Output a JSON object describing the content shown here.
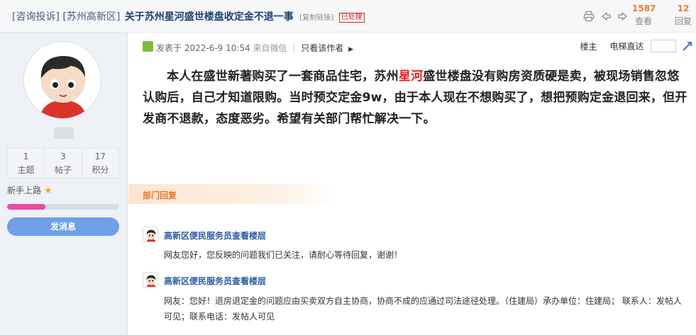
{
  "header": {
    "category1": "[咨询投诉]",
    "category2": "[苏州高新区]",
    "title": "关于苏州星河盛世楼盘收定金不退一事",
    "copy_link": "[复制链接]",
    "status": "已处理",
    "views_count": "1587",
    "views_label": "查看",
    "replies_count": "12",
    "replies_label": "回复",
    "icons": [
      "print-icon",
      "prev-thread-icon",
      "next-thread-icon"
    ]
  },
  "sidebar": {
    "stats": [
      {
        "value": "1",
        "label": "主题"
      },
      {
        "value": "3",
        "label": "帖子"
      },
      {
        "value": "17",
        "label": "积分"
      }
    ],
    "level": "新手上路",
    "level_progress": 0.34,
    "message_button": "发消息"
  },
  "post": {
    "time": "发表于 2022-6-9 10:54",
    "source": "来自微信",
    "only_author": "只看该作者",
    "floor": "楼主",
    "jump_label": "电梯直达",
    "content_before": "本人在盛世新著购买了一套商品住宅，苏州",
    "content_highlight": "星河",
    "content_after": "盛世楼盘没有购房资质硬是卖，被现场销售忽悠认购后，自己才知道限购。当时预交定金9w，由于本人现在不想购买了，想把预购定金退回来，但开发商不退款，态度恶劣。希望有关部门帮忙解决一下。"
  },
  "department": {
    "section_label": "部门回复",
    "replies": [
      {
        "name": "高新区便民服务员查看楼层",
        "text": "网友您好，您反映的问题我们已关注，请耐心等待回复，谢谢！"
      },
      {
        "name": "高新区便民服务员查看楼层",
        "text": "网友：您好！退房退定金的问题应由买卖双方自主协商，协商不成的应通过司法途径处理。（住建局）承办单位：住建局； 联系人：发帖人可见；联系电话：发帖人可见"
      }
    ]
  },
  "colors": {
    "title": "#1f3f73",
    "accent_orange": "#ee7b2f",
    "status_red": "#d2261c",
    "highlight_red": "#e02020",
    "button_blue": "#6f9fe8",
    "progress_pink": "#ec4aa0"
  }
}
